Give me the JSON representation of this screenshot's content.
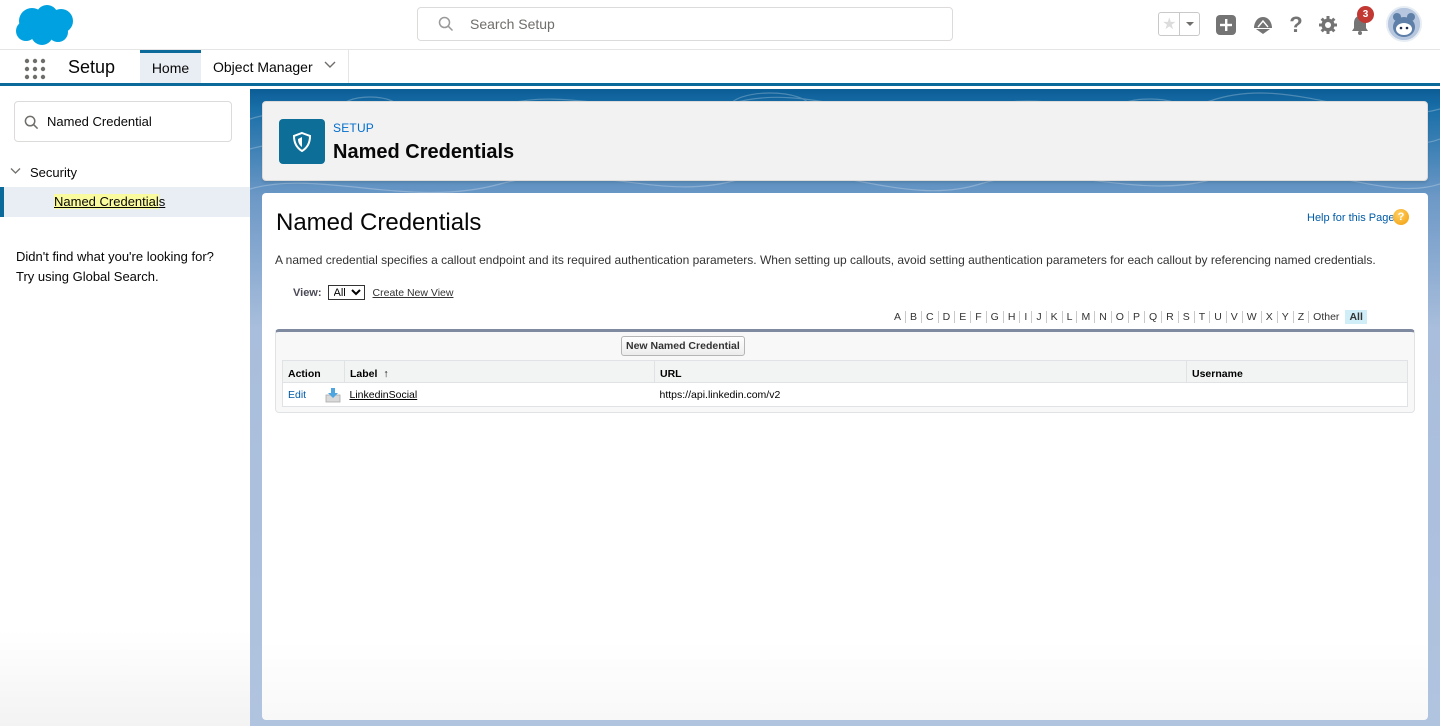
{
  "header": {
    "search_placeholder": "Search Setup",
    "notification_count": "3",
    "icons": [
      "salesforce-cloud-logo",
      "star-icon",
      "chevron-down-icon",
      "plus-icon",
      "trailhead-icon",
      "help-icon",
      "gear-icon",
      "bell-icon",
      "avatar"
    ]
  },
  "nav": {
    "app_name": "Setup",
    "tabs": [
      {
        "label": "Home",
        "active": true
      },
      {
        "label": "Object Manager",
        "active": false
      }
    ]
  },
  "sidebar": {
    "quickfind_value": "Named Credential",
    "section_label": "Security",
    "item_highlight": "Named Credential",
    "item_rest": "s",
    "not_found_line1": "Didn't find what you're looking for?",
    "not_found_line2": "Try using Global Search."
  },
  "page_header": {
    "eyebrow": "SETUP",
    "title": "Named Credentials"
  },
  "content": {
    "title": "Named Credentials",
    "help_link": "Help for this Page",
    "help_icon_glyph": "?",
    "description": "A named credential specifies a callout endpoint and its required authentication parameters. When setting up callouts, avoid setting authentication parameters for each callout by referencing named credentials.",
    "view_label": "View:",
    "view_selected": "All",
    "create_view": "Create New View",
    "alphabet": [
      "A",
      "B",
      "C",
      "D",
      "E",
      "F",
      "G",
      "H",
      "I",
      "J",
      "K",
      "L",
      "M",
      "N",
      "O",
      "P",
      "Q",
      "R",
      "S",
      "T",
      "U",
      "V",
      "W",
      "X",
      "Y",
      "Z",
      "Other"
    ],
    "alphabet_all": "All",
    "new_button": "New Named Credential",
    "columns": [
      "Action",
      "Label",
      "URL",
      "Username"
    ],
    "sort_indicator": "↑",
    "rows": [
      {
        "action": "Edit",
        "label": "LinkedinSocial",
        "url": "https://api.linkedin.com/v2",
        "username": ""
      }
    ]
  },
  "colors": {
    "brand_blue": "#0b6a9a",
    "link_blue": "#015ba7",
    "badge_red": "#c23934",
    "highlight_yellow": "#fafa9e"
  }
}
